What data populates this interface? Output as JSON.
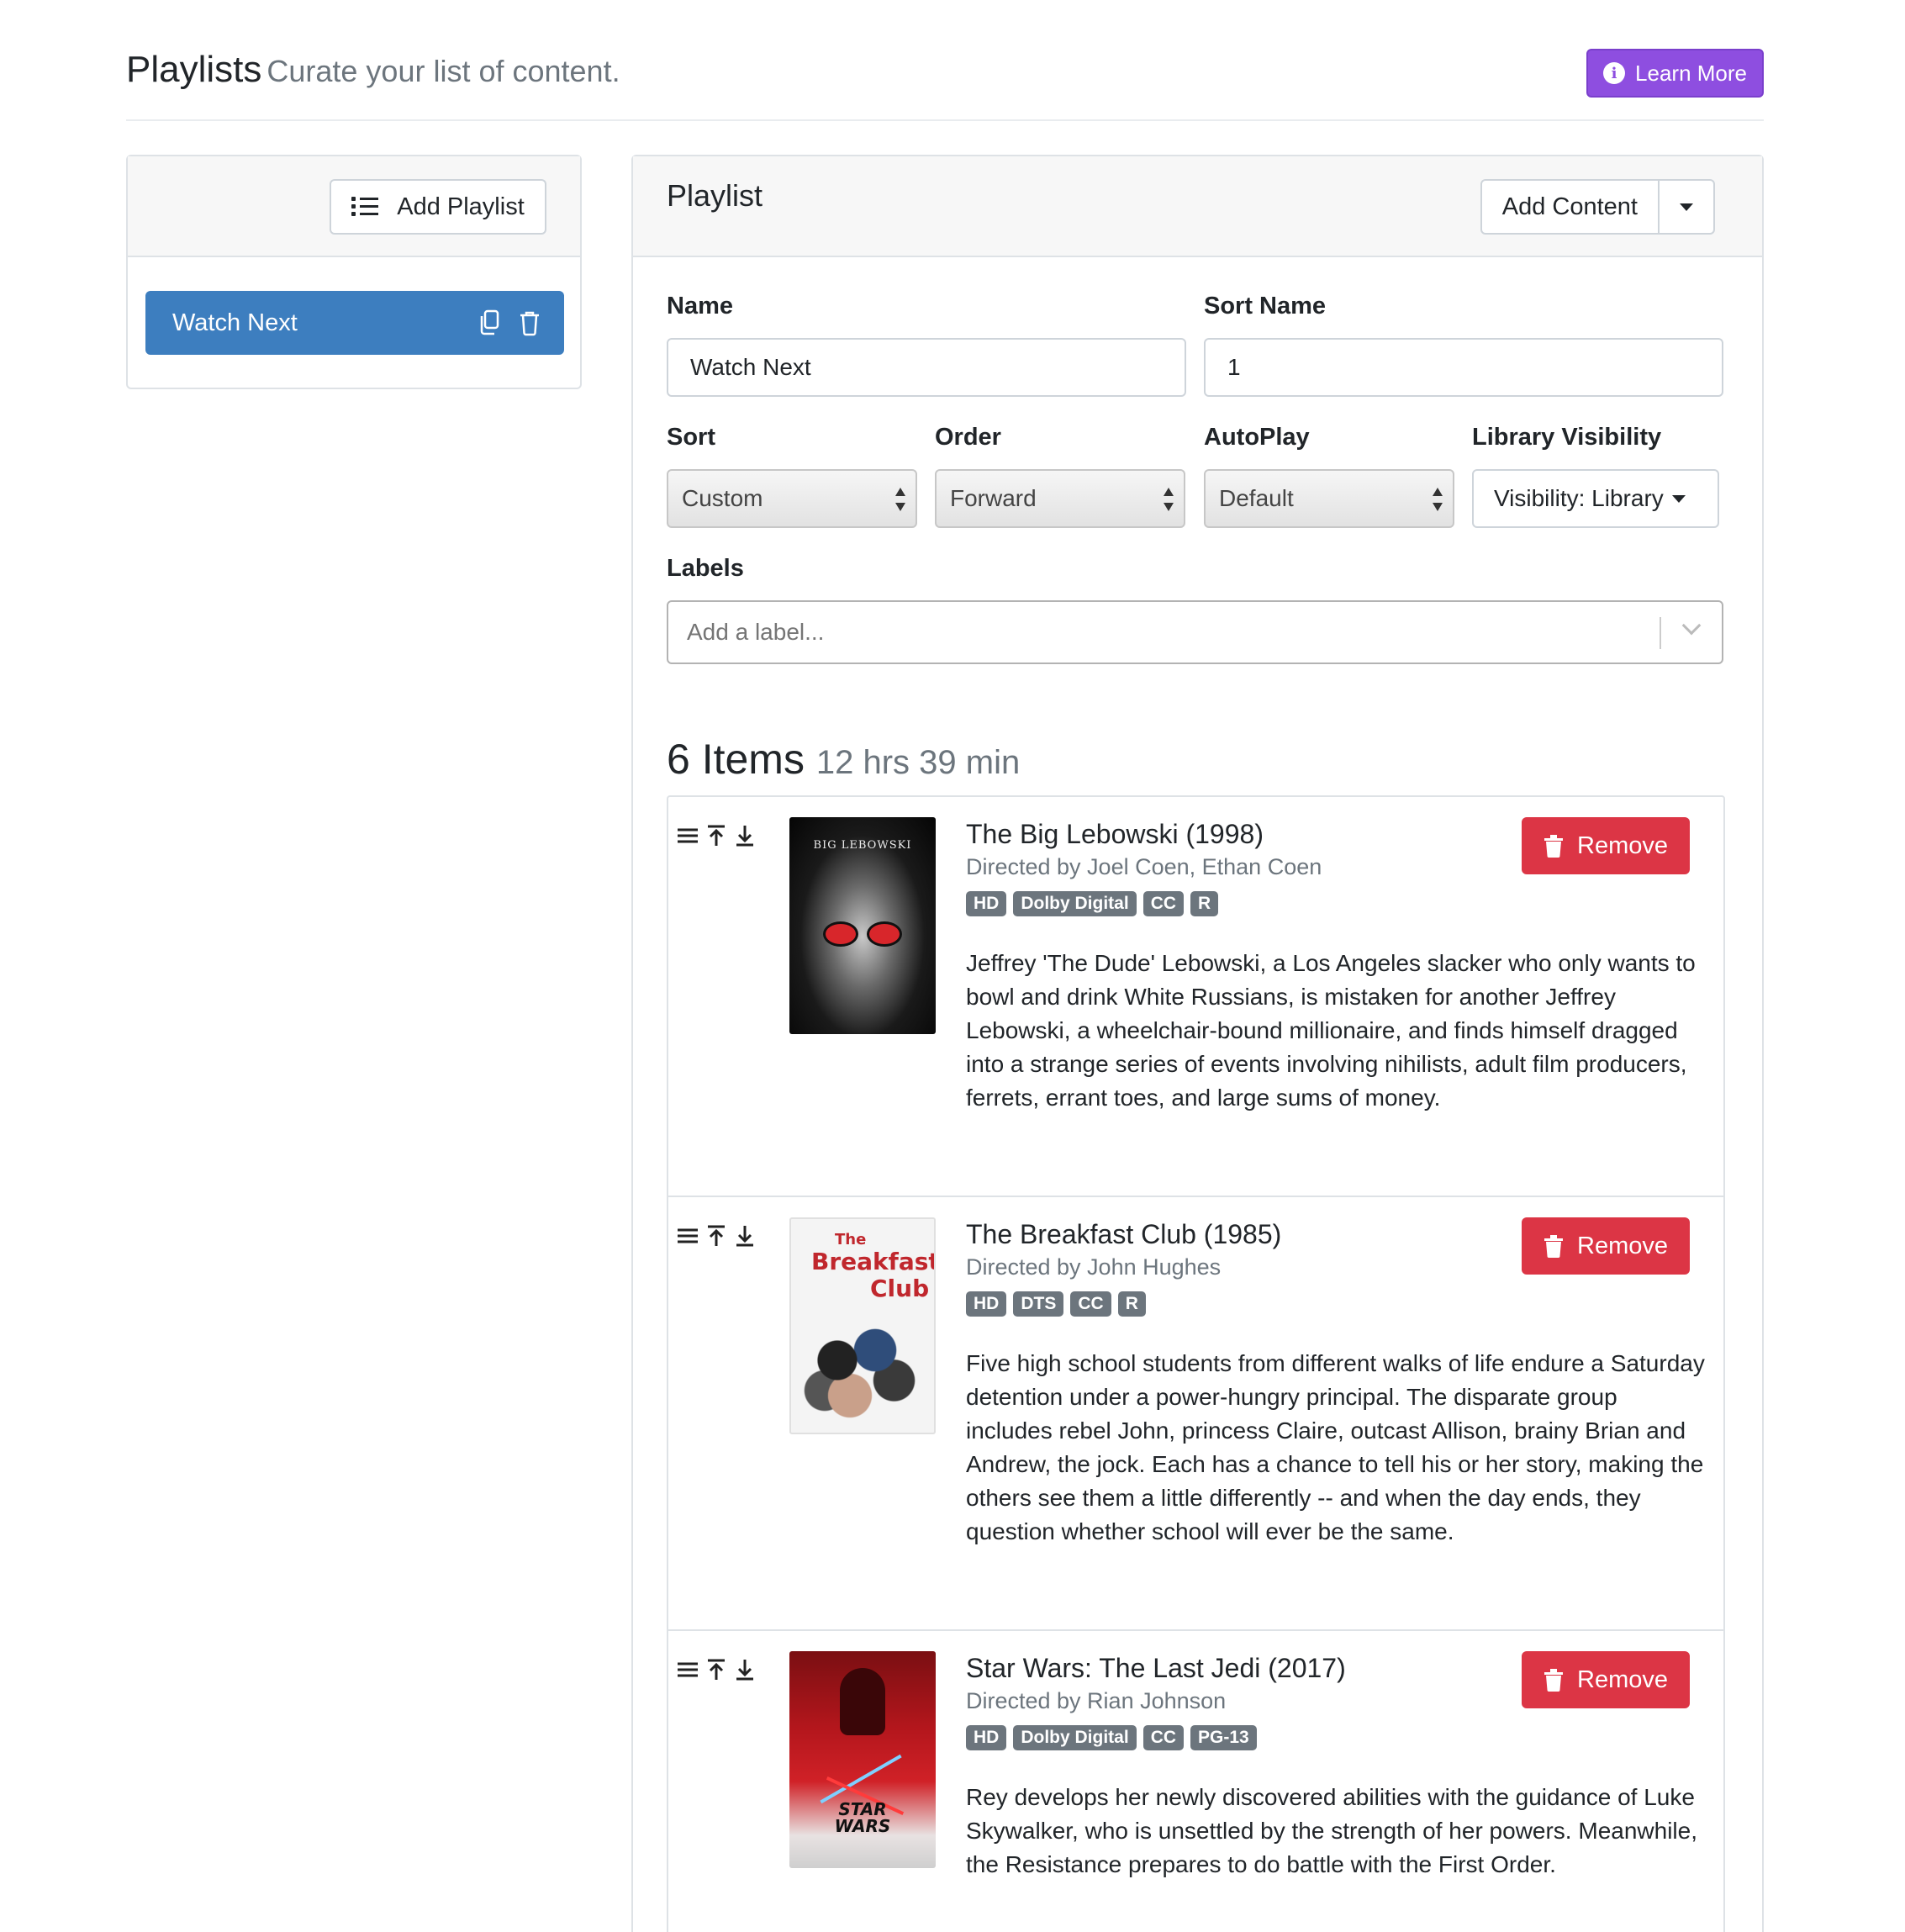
{
  "header": {
    "title": "Playlists",
    "subtitle": "Curate your list of content.",
    "learn_more": "Learn More"
  },
  "sidebar": {
    "add_playlist": "Add Playlist",
    "playlists": [
      {
        "name": "Watch Next",
        "active": true
      }
    ]
  },
  "editor": {
    "title": "Playlist",
    "add_content": "Add Content",
    "name_label": "Name",
    "name_value": "Watch Next",
    "sort_name_label": "Sort Name",
    "sort_name_value": "1",
    "sort_label": "Sort",
    "sort_value": "Custom",
    "order_label": "Order",
    "order_value": "Forward",
    "autoplay_label": "AutoPlay",
    "autoplay_value": "Default",
    "visibility_label": "Library Visibility",
    "visibility_value": "Visibility: Library",
    "labels_label": "Labels",
    "labels_placeholder": "Add a label..."
  },
  "items_summary": {
    "count": "6 Items",
    "duration": "12 hrs 39 min"
  },
  "items": [
    {
      "title": "The Big Lebowski (1998)",
      "director": "Directed by Joel Coen, Ethan Coen",
      "badges": [
        "HD",
        "Dolby Digital",
        "CC",
        "R"
      ],
      "description": "Jeffrey 'The Dude' Lebowski, a Los Angeles slacker who only wants to bowl and drink White Russians, is mistaken for another Jeffrey Lebowski, a wheelchair-bound millionaire, and finds himself dragged into a strange series of events involving nihilists, adult film producers, ferrets, errant toes, and large sums of money.",
      "poster_text": "BIG LEBOWSKI",
      "remove": "Remove"
    },
    {
      "title": "The Breakfast Club (1985)",
      "director": "Directed by John Hughes",
      "badges": [
        "HD",
        "DTS",
        "CC",
        "R"
      ],
      "description": "Five high school students from different walks of life endure a Saturday detention under a power-hungry principal. The disparate group includes rebel John, princess Claire, outcast Allison, brainy Brian and Andrew, the jock. Each has a chance to tell his or her story, making the others see them a little differently -- and when the day ends, they question whether school will ever be the same.",
      "poster_text_small": "The",
      "poster_text": "Breakfast",
      "poster_text_2": "Club",
      "remove": "Remove"
    },
    {
      "title": "Star Wars: The Last Jedi (2017)",
      "director": "Directed by Rian Johnson",
      "badges": [
        "HD",
        "Dolby Digital",
        "CC",
        "PG-13"
      ],
      "description": "Rey develops her newly discovered abilities with the guidance of Luke Skywalker, who is unsettled by the strength of her powers. Meanwhile, the Resistance prepares to do battle with the First Order.",
      "poster_text": "STAR",
      "poster_text_2": "WARS",
      "remove": "Remove"
    }
  ]
}
